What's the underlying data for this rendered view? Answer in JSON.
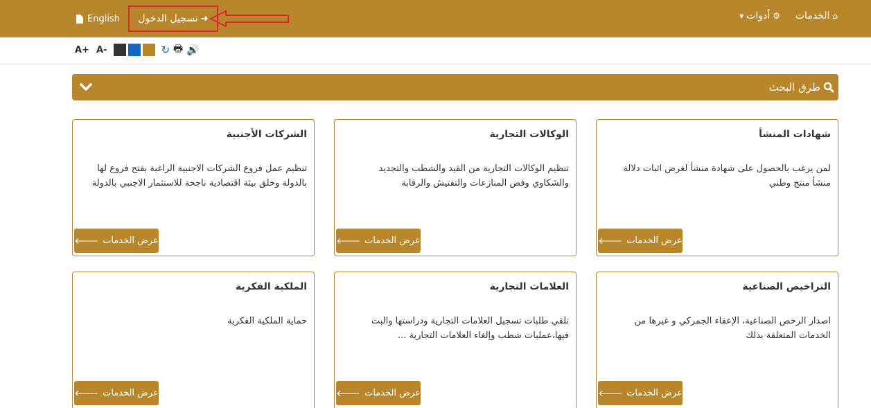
{
  "colors": {
    "brand": "#b8862b",
    "highlight": "#e0282e"
  },
  "topbar": {
    "language_label": "English",
    "login_label": "تسجيل الدخول",
    "services_label": "الخدمات",
    "tools_label": "أدوات"
  },
  "accessibility": {
    "font_increase": "A+",
    "font_decrease": "A-",
    "themes": [
      "#333333",
      "#1266c4",
      "#b8862b"
    ]
  },
  "search": {
    "title": "طرق البحث"
  },
  "cards": [
    {
      "title": "شهادات المنشأ",
      "description": "لمن يرغب بالحصول على شهادة منشأ لغرض اثبات دلالة منشأ منتج وطني",
      "button": "عرض الخدمات"
    },
    {
      "title": "الوكالات التجارية",
      "description": "تنظيم الوكالات التجارية من القيد والشطب والتجديد والشكاوي وفض المنازعات والتفتيش والرقابة",
      "button": "عرض الخدمات"
    },
    {
      "title": "الشركات الأجنبية",
      "description": "تنظيم عمل فروع الشركات الاجنبية الراغبة بفتح فروع لها بالدولة وخلق بيئة اقتصادية ناجحة للاستثمار الاجنبي بالدولة",
      "button": "عرض الخدمات"
    },
    {
      "title": "التراخيص الصناعية",
      "description": "اصدار الرخص الصناعية، الإعفاء الجمركي و غيرها من الخدمات المتعلقة بذلك",
      "button": "عرض الخدمات"
    },
    {
      "title": "العلامات التجارية",
      "description": "تلقي طلبات تسجيل العلامات التجارية ودراستها والبت فيها،عمليات شطب وإلغاء العلامات التجارية ...",
      "button": "عرض الخدمات"
    },
    {
      "title": "الملكية الفكرية",
      "description": "حماية الملكية الفكرية",
      "button": "عرض الخدمات"
    }
  ]
}
